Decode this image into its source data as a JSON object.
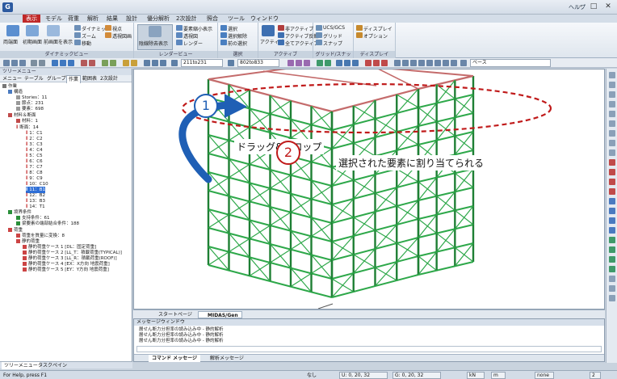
{
  "window": {
    "help_label": "ヘルプ",
    "min_glyph": "–",
    "max_glyph": "□",
    "close_glyph": "✕"
  },
  "ribbon_tabs": [
    "表示",
    "モデル",
    "荷重",
    "解析",
    "結果",
    "設計",
    "優分解析",
    "2次設計",
    "照合",
    "ツール",
    "ウィンドウ"
  ],
  "ribbon_active_tab": "表示",
  "ribbon": {
    "groups": {
      "dynamic": "ダイナミックビュー",
      "render": "レンダービュー",
      "select": "選択",
      "active": "アクティブ",
      "grid": "グリッド/スナップ",
      "display": "ディスプレイ"
    },
    "labels": {
      "bidirectional_view": "両端面",
      "initial_view": "初期画面",
      "front_view": "前画面を表示",
      "dynamic": "ダイナミック",
      "zoom": "ズーム",
      "move": "移動",
      "viewpoint": "視点",
      "perspective": "透視図画",
      "hidden_line": "陰線除去表示",
      "shrink_display": "要素縮小表示",
      "transparent": "透視図",
      "render": "レンダー",
      "select": "選択",
      "deselect": "選択解除",
      "prev_select": "前の選択",
      "active": "アクティブ",
      "non_active": "非アクティブ",
      "active_invert": "アクティブ反転",
      "all_active": "全てアクティブ",
      "ucs": "UCS/GCS",
      "grid": "グリッド",
      "snap": "スナップ",
      "display": "ディスプレイ",
      "option": "オプション"
    }
  },
  "toolbar": {
    "combo1": "211to231",
    "combo2": "802to833",
    "combo3": "ベース"
  },
  "tree": {
    "title": "ツリーメニュー",
    "tabs": [
      "メニュー",
      "テーブル",
      "グループ",
      "作業",
      "範囲表",
      "2次設計"
    ],
    "active_tab": "作業",
    "items": [
      "作業",
      "構造",
      "Stories：11",
      "節点：231",
      "要素：698",
      "材料＆断面",
      "材料：1",
      "断面：14",
      "1：C1",
      "2：C2",
      "3：C3",
      "4：C4",
      "5：C5",
      "6：C6",
      "7：C7",
      "8：C8",
      "9：C9",
      "10：C10",
      "11：B1",
      "12：B2",
      "13：B3",
      "14：T1",
      "境界条件",
      "支持条件：61",
      "梁要素の端部結合条件：188",
      "荷重",
      "荷重を質量に変換：8",
      "静的荷重",
      "静的荷重ケース 1 [DL：固定荷重]",
      "静的荷重ケース 2 [LL_T：積載荷重(TYPICAL)]",
      "静的荷重ケース 3 [LL_R：積載荷重(ROOF)]",
      "静的荷重ケース 4 [EX：X方向 地震荷重]",
      "静的荷重ケース 5 [EY：Y方向 地震荷重]"
    ],
    "bottom_tabs": [
      "ツリーメニュー",
      "タスクペイン"
    ]
  },
  "viewport": {
    "annotation_1_number": "1",
    "annotation_1_text": "ドラッグ&ドロップ",
    "annotation_2_number": "2",
    "annotation_2_text": "選択された要素に割り当てられる",
    "colors": {
      "member": "#2ea84a",
      "member_dark": "#1e7f34",
      "selected": "#c46b6b",
      "ellipse": "#c01a1a",
      "arrow": "#1f5fb5"
    }
  },
  "view_tabs": [
    "スタートページ",
    "MIDAS/Gen"
  ],
  "view_active_tab": "MIDAS/Gen",
  "messages": {
    "title": "メッセージウィンドウ",
    "lines": [
      "層せん断力分担率の読み込み中 - 静的解析",
      "層せん断力分担率の読み込み中 - 静的解析",
      "層せん断力分担率の読み込み中 - 静的解析"
    ],
    "tabs": [
      "コマンド メッセージ",
      "解析メッセージ"
    ],
    "active_tab": "コマンド メッセージ"
  },
  "status": {
    "help": "For Help, press F1",
    "none": "なし",
    "coord_u": "U: 0, 20, 32",
    "coord_g": "G: 0, 20, 32",
    "unit_force": "kN",
    "unit_length": "m",
    "none2": "none",
    "page": "2"
  }
}
